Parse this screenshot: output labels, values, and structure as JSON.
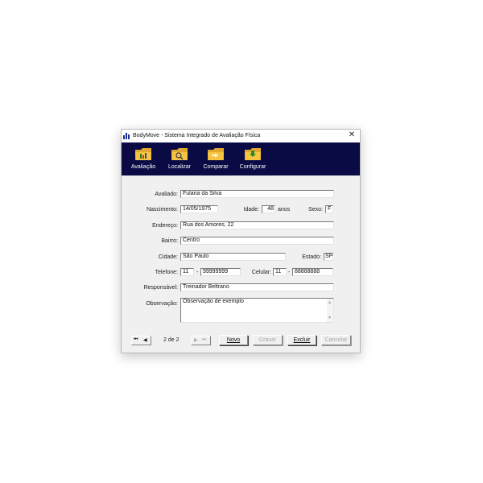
{
  "window": {
    "title": "BodyMove - Sistema Integrado de Avaliação Física",
    "close_glyph": "✕"
  },
  "toolbar": [
    {
      "label": "Avaliação",
      "icon": "folder-chart-icon"
    },
    {
      "label": "Localizar",
      "icon": "folder-search-icon"
    },
    {
      "label": "Comparar",
      "icon": "folder-compare-icon"
    },
    {
      "label": "Configurar",
      "icon": "folder-download-icon"
    }
  ],
  "colors": {
    "toolbar_bg": "#0a0a45",
    "window_bg": "#f0f0f0",
    "folder": "#f5c542"
  },
  "form": {
    "avaliado": {
      "label": "Avaliado:",
      "value": "Fulana da Silva"
    },
    "nascimento": {
      "label": "Nascimento:",
      "value": "14/05/1975"
    },
    "idade": {
      "label": "Idade:",
      "value": "48",
      "unit": "anos"
    },
    "sexo": {
      "label": "Sexo:",
      "value": "F"
    },
    "endereco": {
      "label": "Endereço:",
      "value": "Rua dos Amores, 22"
    },
    "bairro": {
      "label": "Bairro:",
      "value": "Centro"
    },
    "cidade": {
      "label": "Cidade:",
      "value": "São Paulo"
    },
    "estado": {
      "label": "Estado:",
      "value": "SP"
    },
    "telefone": {
      "label": "Telefone:",
      "ddd": "11",
      "numero": "99999999"
    },
    "celular": {
      "label": "Celular:",
      "ddd": "11",
      "numero": "88888888"
    },
    "responsavel": {
      "label": "Responsável:",
      "value": "Treinador Beltrano"
    },
    "observacao": {
      "label": "Observação:",
      "value": "Observação de exemplo"
    },
    "dash": "-"
  },
  "nav": {
    "record_info": "2 de 2",
    "first": "⏮",
    "prev": "◀",
    "next": "▶",
    "last": "⏭"
  },
  "buttons": {
    "novo": "Novo",
    "gravar": "Gravar",
    "excluir": "Excluir",
    "cancelar": "Cancelar"
  }
}
